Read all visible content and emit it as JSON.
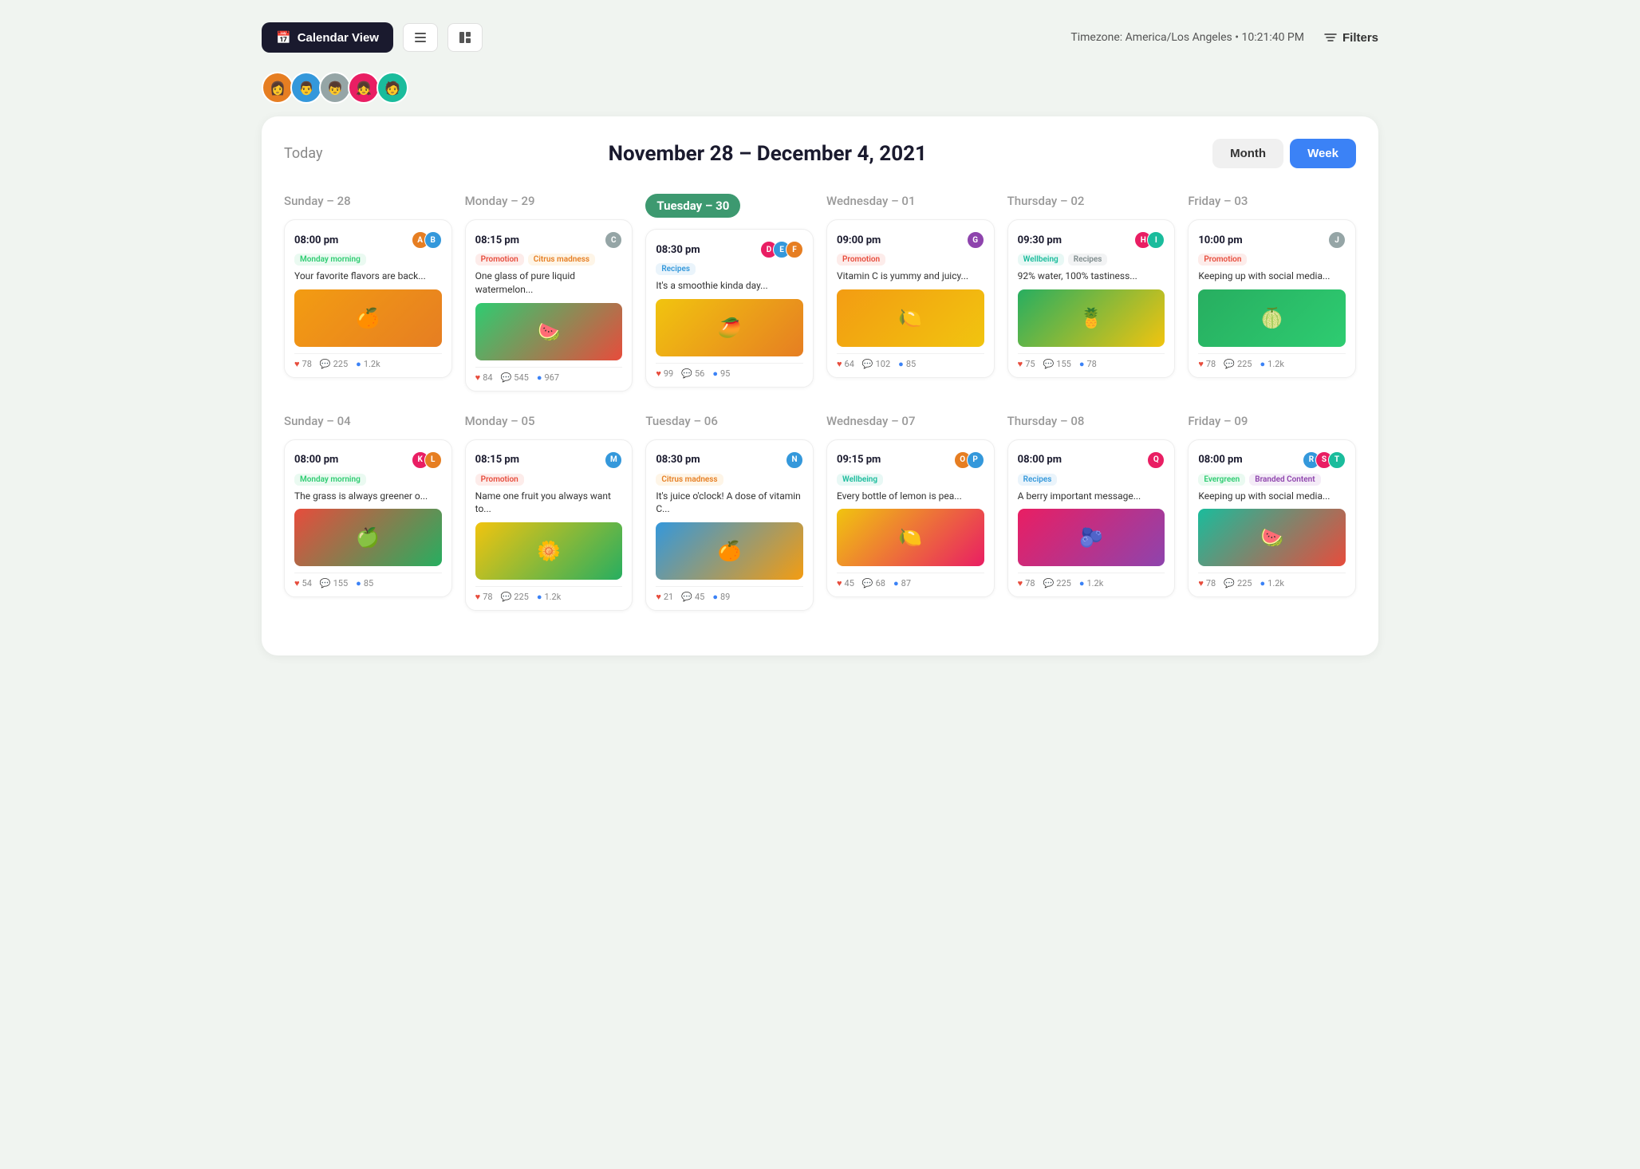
{
  "topbar": {
    "calendar_view_label": "Calendar View",
    "timezone_text": "Timezone: America/Los Angeles • 10:21:40 PM",
    "filters_label": "Filters"
  },
  "calendar": {
    "today_label": "Today",
    "title": "November 28 – December 4, 2021",
    "month_label": "Month",
    "week_label": "Week"
  },
  "week1": {
    "days": [
      {
        "label": "Sunday – 28",
        "active": false,
        "post": {
          "time": "08:00 pm",
          "avatars": [
            {
              "color": "av-orange",
              "letter": "A"
            },
            {
              "color": "av-blue",
              "letter": "B"
            }
          ],
          "tags": [
            {
              "label": "Monday morning",
              "class": "tag-green"
            }
          ],
          "text": "Your favorite flavors are back...",
          "image_class": "img-orange",
          "image_emoji": "🍊",
          "stats": {
            "hearts": "78",
            "comments": "225",
            "shares": "1.2k"
          }
        }
      },
      {
        "label": "Monday – 29",
        "active": false,
        "post": {
          "time": "08:15 pm",
          "avatars": [
            {
              "color": "av-gray",
              "letter": "C"
            }
          ],
          "tags": [
            {
              "label": "Promotion",
              "class": "tag-red"
            },
            {
              "label": "Citrus madness",
              "class": "tag-orange"
            }
          ],
          "text": "One glass of pure liquid watermelon...",
          "image_class": "img-watermelon",
          "image_emoji": "🍉",
          "stats": {
            "hearts": "84",
            "comments": "545",
            "shares": "967"
          }
        }
      },
      {
        "label": "Tuesday – 30",
        "active": true,
        "post": {
          "time": "08:30 pm",
          "avatars": [
            {
              "color": "av-pink",
              "letter": "D"
            },
            {
              "color": "av-blue",
              "letter": "E"
            },
            {
              "color": "av-orange",
              "letter": "F"
            }
          ],
          "tags": [
            {
              "label": "Recipes",
              "class": "tag-blue"
            }
          ],
          "text": "It's a smoothie kinda day...",
          "image_class": "img-mango",
          "image_emoji": "🥭",
          "stats": {
            "hearts": "99",
            "comments": "56",
            "shares": "95"
          }
        }
      },
      {
        "label": "Wednesday – 01",
        "active": false,
        "post": {
          "time": "09:00 pm",
          "avatars": [
            {
              "color": "av-purple",
              "letter": "G"
            }
          ],
          "tags": [
            {
              "label": "Promotion",
              "class": "tag-red"
            }
          ],
          "text": "Vitamin C is yummy and juicy...",
          "image_class": "img-citrus",
          "image_emoji": "🍋",
          "stats": {
            "hearts": "64",
            "comments": "102",
            "shares": "85"
          }
        }
      },
      {
        "label": "Thursday – 02",
        "active": false,
        "post": {
          "time": "09:30 pm",
          "avatars": [
            {
              "color": "av-pink",
              "letter": "H"
            },
            {
              "color": "av-teal",
              "letter": "I"
            }
          ],
          "tags": [
            {
              "label": "Wellbeing",
              "class": "tag-teal"
            },
            {
              "label": "Recipes",
              "class": "tag-gray"
            }
          ],
          "text": "92% water, 100% tastiness...",
          "image_class": "img-pineapple",
          "image_emoji": "🍍",
          "stats": {
            "hearts": "75",
            "comments": "155",
            "shares": "78"
          }
        }
      },
      {
        "label": "Friday – 03",
        "active": false,
        "post": {
          "time": "10:00 pm",
          "avatars": [
            {
              "color": "av-gray",
              "letter": "J"
            }
          ],
          "tags": [
            {
              "label": "Promotion",
              "class": "tag-red"
            }
          ],
          "text": "Keeping up with social media...",
          "image_class": "img-green-citrus",
          "image_emoji": "🍈",
          "stats": {
            "hearts": "78",
            "comments": "225",
            "shares": "1.2k"
          }
        }
      }
    ]
  },
  "week2": {
    "days": [
      {
        "label": "Sunday – 04",
        "post": {
          "time": "08:00 pm",
          "avatars": [
            {
              "color": "av-pink",
              "letter": "K"
            },
            {
              "color": "av-orange",
              "letter": "L"
            }
          ],
          "tags": [
            {
              "label": "Monday morning",
              "class": "tag-green"
            }
          ],
          "text": "The grass is always greener o...",
          "image_class": "img-apples",
          "image_emoji": "🍏",
          "stats": {
            "hearts": "54",
            "comments": "155",
            "shares": "85"
          }
        }
      },
      {
        "label": "Monday – 05",
        "post": {
          "time": "08:15 pm",
          "avatars": [
            {
              "color": "av-blue",
              "letter": "M"
            }
          ],
          "tags": [
            {
              "label": "Promotion",
              "class": "tag-red"
            }
          ],
          "text": "Name one fruit you always want to...",
          "image_class": "img-flowers",
          "image_emoji": "🌼",
          "stats": {
            "hearts": "78",
            "comments": "225",
            "shares": "1.2k"
          }
        }
      },
      {
        "label": "Tuesday – 06",
        "post": {
          "time": "08:30 pm",
          "avatars": [
            {
              "color": "av-blue",
              "letter": "N"
            }
          ],
          "tags": [
            {
              "label": "Citrus madness",
              "class": "tag-orange"
            }
          ],
          "text": "It's juice o'clock! A dose of vitamin C...",
          "image_class": "img-orange-juice",
          "image_emoji": "🍊",
          "stats": {
            "hearts": "21",
            "comments": "45",
            "shares": "89"
          }
        }
      },
      {
        "label": "Wednesday – 07",
        "post": {
          "time": "09:15 pm",
          "avatars": [
            {
              "color": "av-orange",
              "letter": "O"
            },
            {
              "color": "av-blue",
              "letter": "P"
            }
          ],
          "tags": [
            {
              "label": "Wellbeing",
              "class": "tag-teal"
            }
          ],
          "text": "Every bottle of lemon is pea...",
          "image_class": "img-lemons",
          "image_emoji": "🍋",
          "stats": {
            "hearts": "45",
            "comments": "68",
            "shares": "87"
          }
        }
      },
      {
        "label": "Thursday – 08",
        "post": {
          "time": "08:00 pm",
          "avatars": [
            {
              "color": "av-pink",
              "letter": "Q"
            }
          ],
          "tags": [
            {
              "label": "Recipes",
              "class": "tag-blue"
            }
          ],
          "text": "A berry important message...",
          "image_class": "img-berries",
          "image_emoji": "🫐",
          "stats": {
            "hearts": "78",
            "comments": "225",
            "shares": "1.2k"
          }
        }
      },
      {
        "label": "Friday – 09",
        "post": {
          "time": "08:00 pm",
          "avatars": [
            {
              "color": "av-blue",
              "letter": "R"
            },
            {
              "color": "av-pink",
              "letter": "S"
            },
            {
              "color": "av-teal",
              "letter": "T"
            }
          ],
          "tags": [
            {
              "label": "Evergreen",
              "class": "tag-green"
            },
            {
              "label": "Branded Content",
              "class": "tag-purple"
            }
          ],
          "text": "Keeping up with social media...",
          "image_class": "img-watermelon2",
          "image_emoji": "🍉",
          "stats": {
            "hearts": "78",
            "comments": "225",
            "shares": "1.2k"
          }
        }
      }
    ]
  }
}
